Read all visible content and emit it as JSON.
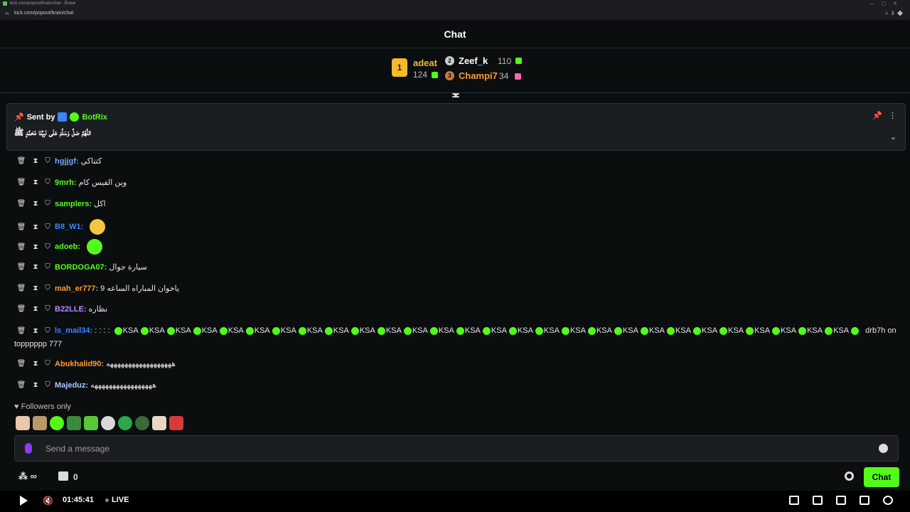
{
  "browser": {
    "tab_title": "kick.com/popout/brain/chat - Brave",
    "url": "kick.com/popout/brain/chat"
  },
  "header": {
    "title": "Chat"
  },
  "leaderboard": {
    "first": {
      "rank": "1",
      "name": "adeat",
      "count": "124"
    },
    "second": {
      "rank": "2",
      "name": "Zeef_k",
      "count": "110"
    },
    "third": {
      "rank": "3",
      "name": "Champi7",
      "count": "34"
    }
  },
  "pinned": {
    "sent_by_label": "Sent by",
    "sender": "BotRix",
    "message": "اللَّهُمَّ صَلِّ وَسَلِّمْ عَلَى نَبِيِّنَا مُحَمَّدٍ ﷺ"
  },
  "messages": [
    {
      "user": "hgjjgf",
      "color": "#6fa8ff",
      "text": "كتتاكي",
      "emote": ""
    },
    {
      "user": "9mrh",
      "color": "#53fc18",
      "text": "وين الفيس كام",
      "emote": ""
    },
    {
      "user": "samplers",
      "color": "#53fc18",
      "text": "اكل",
      "emote": ""
    },
    {
      "user": "B8_W1",
      "color": "#3a86ff",
      "text": "",
      "emote": "laugh"
    },
    {
      "user": "adoeb",
      "color": "#53fc18",
      "text": "",
      "emote": "ghost"
    },
    {
      "user": "BORDOGA07",
      "color": "#53fc18",
      "text": "سيارة جوال",
      "emote": ""
    },
    {
      "user": "mah_er777",
      "color": "#ff9933",
      "text": "ياخوان المباراه الساعه 9",
      "emote": ""
    },
    {
      "user": "B22LLE",
      "color": "#bb88ff",
      "text": "نظاره",
      "emote": ""
    }
  ],
  "long_message": {
    "user": "ls_mail34",
    "color": "#3a86ff",
    "prefix": ": : : :",
    "repeat_word": "KSA",
    "repeat_count": 28,
    "suffix": "drb7h on topppppp 777"
  },
  "messages_bottom": [
    {
      "user": "Abukhalid90",
      "color": "#ff9933",
      "text": "ههههههههههههههههههه"
    },
    {
      "user": "Majeduz",
      "color": "#a9c8ff",
      "text": "هههههههههههههههههه"
    }
  ],
  "followers_label": "Followers only",
  "input": {
    "placeholder": "Send a message"
  },
  "footer": {
    "kicks": "∞",
    "store_count": "0",
    "chat_button": "Chat"
  },
  "player": {
    "time": "01:45:41",
    "live": "LIVE"
  },
  "colors": {
    "accent": "#53fc18",
    "gold": "#f5b82e"
  }
}
